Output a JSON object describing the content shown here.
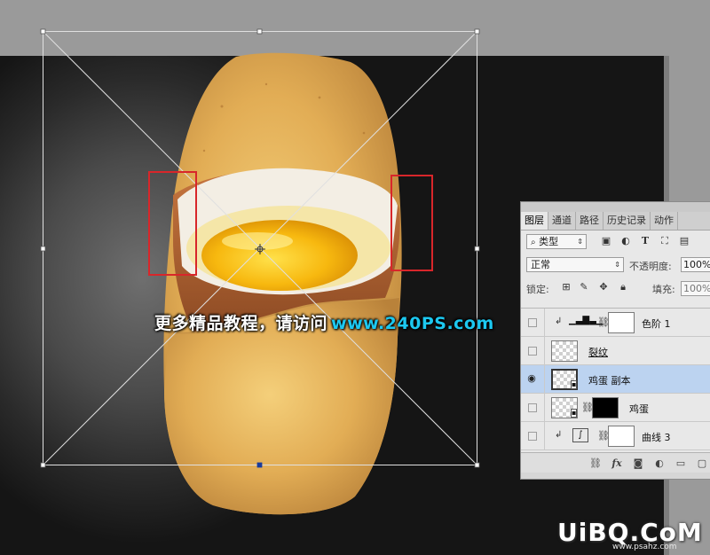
{
  "watermark": {
    "text_cn": "更多精品教程，请访问",
    "url": "www.240PS.com"
  },
  "corner_logo": {
    "main": "UiBQ.CoM",
    "sub": "www.psahz.com"
  },
  "layers_panel": {
    "tabs": [
      {
        "label": "图层",
        "active": true
      },
      {
        "label": "通道",
        "active": false
      },
      {
        "label": "路径",
        "active": false
      },
      {
        "label": "历史记录",
        "active": false
      },
      {
        "label": "动作",
        "active": false
      }
    ],
    "filter_kind_label": "类型",
    "filter_icons": [
      "image-filter-icon",
      "adjustment-filter-icon",
      "type-filter-icon",
      "shape-filter-icon",
      "smart-object-filter-icon"
    ],
    "blend_mode": "正常",
    "opacity_label": "不透明度:",
    "opacity_value": "100%",
    "lock_label": "锁定:",
    "fill_label": "填充:",
    "fill_value": "100%",
    "layers": [
      {
        "name": "色阶 1",
        "visible": false,
        "selected": false,
        "kind": "adjustment-levels",
        "clipped": true
      },
      {
        "name": "裂纹",
        "visible": false,
        "selected": false,
        "kind": "pixel",
        "clipped": false
      },
      {
        "name": "鸡蛋 副本",
        "visible": true,
        "selected": true,
        "kind": "smart-object",
        "clipped": false
      },
      {
        "name": "鸡蛋",
        "visible": false,
        "selected": false,
        "kind": "smart-object-masked",
        "clipped": false
      },
      {
        "name": "曲线 3",
        "visible": false,
        "selected": false,
        "kind": "adjustment-curves",
        "clipped": true
      }
    ],
    "footer_buttons": [
      "link-layers-icon",
      "fx-icon",
      "add-mask-icon",
      "new-adjustment-icon",
      "new-group-icon",
      "new-layer-icon"
    ]
  },
  "colors": {
    "workspace": "#9a9a9a",
    "selection_highlight": "#bcd3f0",
    "watermark_url": "#1cc8f0",
    "annotation_red": "#d8262a"
  }
}
